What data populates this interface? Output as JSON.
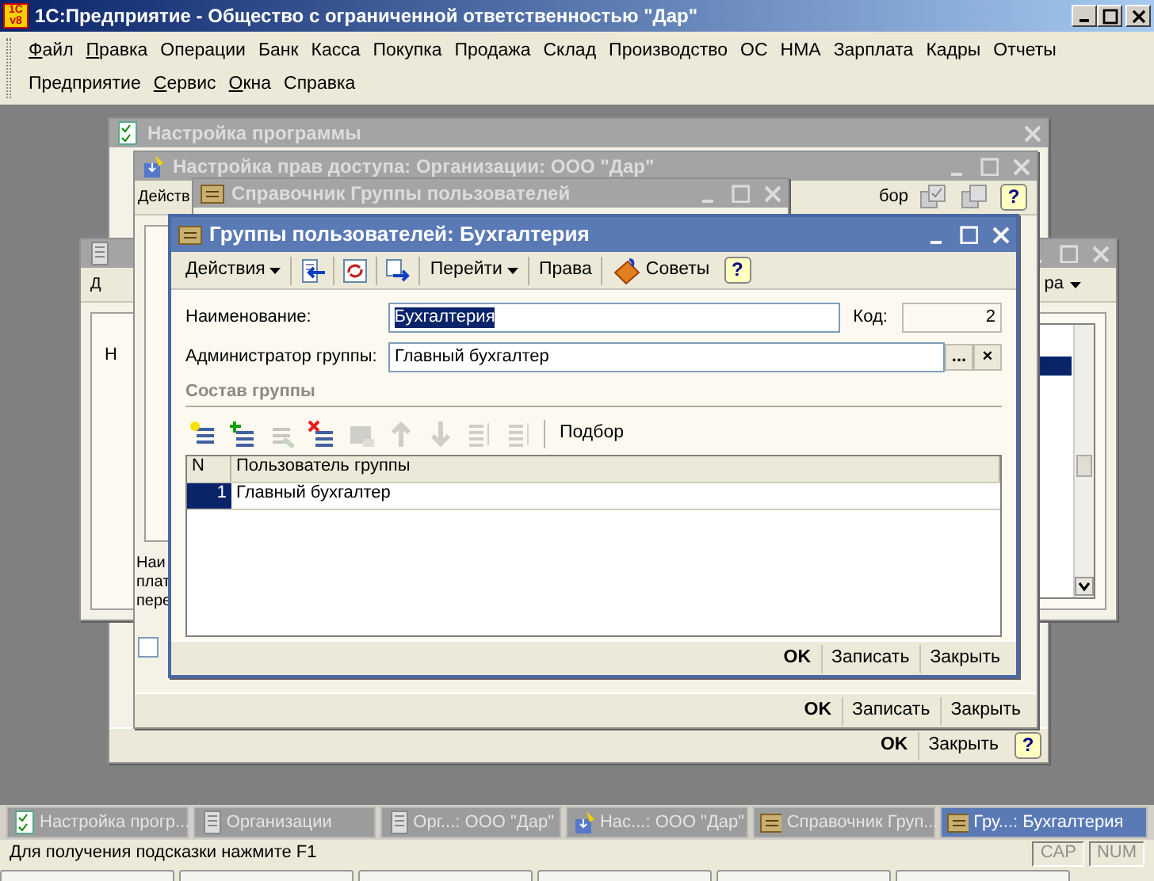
{
  "app": {
    "logo": {
      "top": "1С",
      "bottom": "v8"
    },
    "title": "1С:Предприятие - Общество с ограниченной ответственностью \"Дар\""
  },
  "menu_rows": [
    {
      "items": [
        {
          "label": "Файл",
          "access_key": true
        },
        {
          "label": "Правка",
          "access_key": true
        },
        {
          "label": "Операции",
          "access_key": false
        },
        {
          "label": "Банк",
          "access_key": false
        },
        {
          "label": "Касса",
          "access_key": false
        },
        {
          "label": "Покупка",
          "access_key": false
        },
        {
          "label": "Продажа",
          "access_key": false
        },
        {
          "label": "Склад",
          "access_key": false
        },
        {
          "label": "Производство",
          "access_key": false
        },
        {
          "label": "ОС",
          "access_key": false
        },
        {
          "label": "НМА",
          "access_key": false
        },
        {
          "label": "Зарплата",
          "access_key": false
        },
        {
          "label": "Кадры",
          "access_key": false
        },
        {
          "label": "Отчеты",
          "access_key": false
        }
      ]
    },
    {
      "items": [
        {
          "label": "Предприятие",
          "access_key": false
        },
        {
          "label": "Сервис",
          "access_key": true
        },
        {
          "label": "Окна",
          "access_key": true
        },
        {
          "label": "Справка",
          "access_key": false
        }
      ]
    }
  ],
  "background_windows": [
    {
      "title": "Настройка программы",
      "footer_buttons": [
        {
          "label": "OK",
          "default": true
        },
        {
          "label": "Закрыть",
          "default": false
        }
      ],
      "help": "?"
    },
    {
      "toolbar_left": "Д",
      "toolbar_right": "ра",
      "body_texts": [
        "Н"
      ]
    },
    {
      "title": "Настройка прав доступа: Организации: ООО \"Дар\"",
      "toolbar_left": "Действ",
      "toolbar_right": "бор",
      "help": "?",
      "body_texts": [
        "Наи",
        "плат",
        "пере"
      ],
      "checkbox": {
        "checked": false
      },
      "footer_buttons": [
        {
          "label": "OK",
          "default": true
        },
        {
          "label": "Записать",
          "default": false
        },
        {
          "label": "Закрыть",
          "default": false
        }
      ]
    },
    {
      "title": "Справочник Группы пользователей"
    }
  ],
  "dialog": {
    "title": "Группы пользователей: Бухгалтерия",
    "toolbar": [
      {
        "kind": "menu",
        "label": "Действия"
      },
      {
        "kind": "icon"
      },
      {
        "kind": "icon"
      },
      {
        "kind": "icon"
      },
      {
        "kind": "menu",
        "label": "Перейти"
      },
      {
        "kind": "text",
        "label": "Права"
      },
      {
        "kind": "tips",
        "label": "Советы"
      },
      {
        "kind": "help",
        "label": "?"
      }
    ],
    "fields": {
      "name_label": "Наименование:",
      "name_value": "Бухгалтерия",
      "name_selected": true,
      "code_label": "Код:",
      "code_value": "2",
      "admin_label": "Администратор группы:",
      "admin_value": "Главный бухгалтер",
      "select_button": "...",
      "clear_button": "×"
    },
    "section": "Состав группы",
    "table_toolbar": {
      "tools": [
        {
          "disabled": false
        },
        {
          "disabled": false
        },
        {
          "disabled": true
        },
        {
          "disabled": false
        },
        {
          "disabled": true
        },
        {
          "disabled": true
        },
        {
          "disabled": true
        },
        {
          "disabled": true
        },
        {
          "disabled": true
        }
      ],
      "pick": "Подбор"
    },
    "table": {
      "columns": [
        "N",
        "Пользователь группы"
      ],
      "rows": [
        {
          "cells": [
            "1",
            "Главный бухгалтер"
          ],
          "selected": true
        }
      ]
    },
    "footer_buttons": [
      {
        "label": "OK",
        "default": true
      },
      {
        "label": "Записать",
        "default": false
      },
      {
        "label": "Закрыть",
        "default": false
      }
    ]
  },
  "window_tabs": [
    {
      "label": "Настройка прогр...",
      "selected": false
    },
    {
      "label": "Организации",
      "selected": false
    },
    {
      "label": "Орг...: ООО \"Дар\"",
      "selected": false
    },
    {
      "label": "Нас...: ООО \"Дар\"",
      "selected": false
    },
    {
      "label": "Справочник Груп...",
      "selected": false
    },
    {
      "label": "Гру...: Бухгалтерия",
      "selected": true
    }
  ],
  "status_bar": {
    "hint": "Для получения подсказки нажмите F1",
    "indicators": [
      {
        "label": "CAP",
        "on": false
      },
      {
        "label": "NUM",
        "on": false
      }
    ]
  }
}
